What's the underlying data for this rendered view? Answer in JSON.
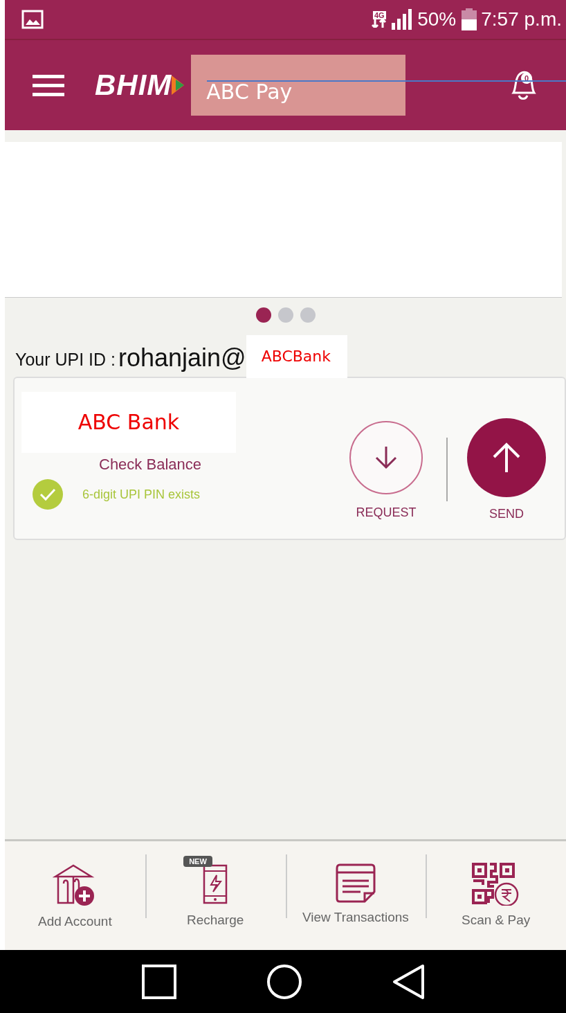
{
  "status_bar": {
    "network": "4G",
    "battery_text": "50%",
    "time": "7:57 p.m."
  },
  "header": {
    "logo": "BHIM",
    "app_label": "ABC Pay",
    "notification_count": "0"
  },
  "carousel": {
    "dots": [
      {
        "selected": true
      },
      {
        "selected": false
      },
      {
        "selected": false
      }
    ]
  },
  "upi_id": {
    "label": "Your UPI ID :",
    "value": "rohanjain@",
    "bank_tag": "ABCBank"
  },
  "account_card": {
    "bank_name": "ABC Bank",
    "check_balance": "Check Balance",
    "pin_status": "6-digit UPI PIN exists",
    "pin_set": true,
    "actions": [
      {
        "label": "REQUEST",
        "kind": "request"
      },
      {
        "label": "SEND",
        "kind": "send"
      }
    ]
  },
  "bottom_nav": [
    {
      "label": "Add Account",
      "kind": "bank"
    },
    {
      "label": "Recharge",
      "kind": "phone",
      "badge": "NEW"
    },
    {
      "label": "View Transactions",
      "kind": "receipt"
    },
    {
      "label": "Scan & Pay",
      "kind": "qr"
    }
  ]
}
